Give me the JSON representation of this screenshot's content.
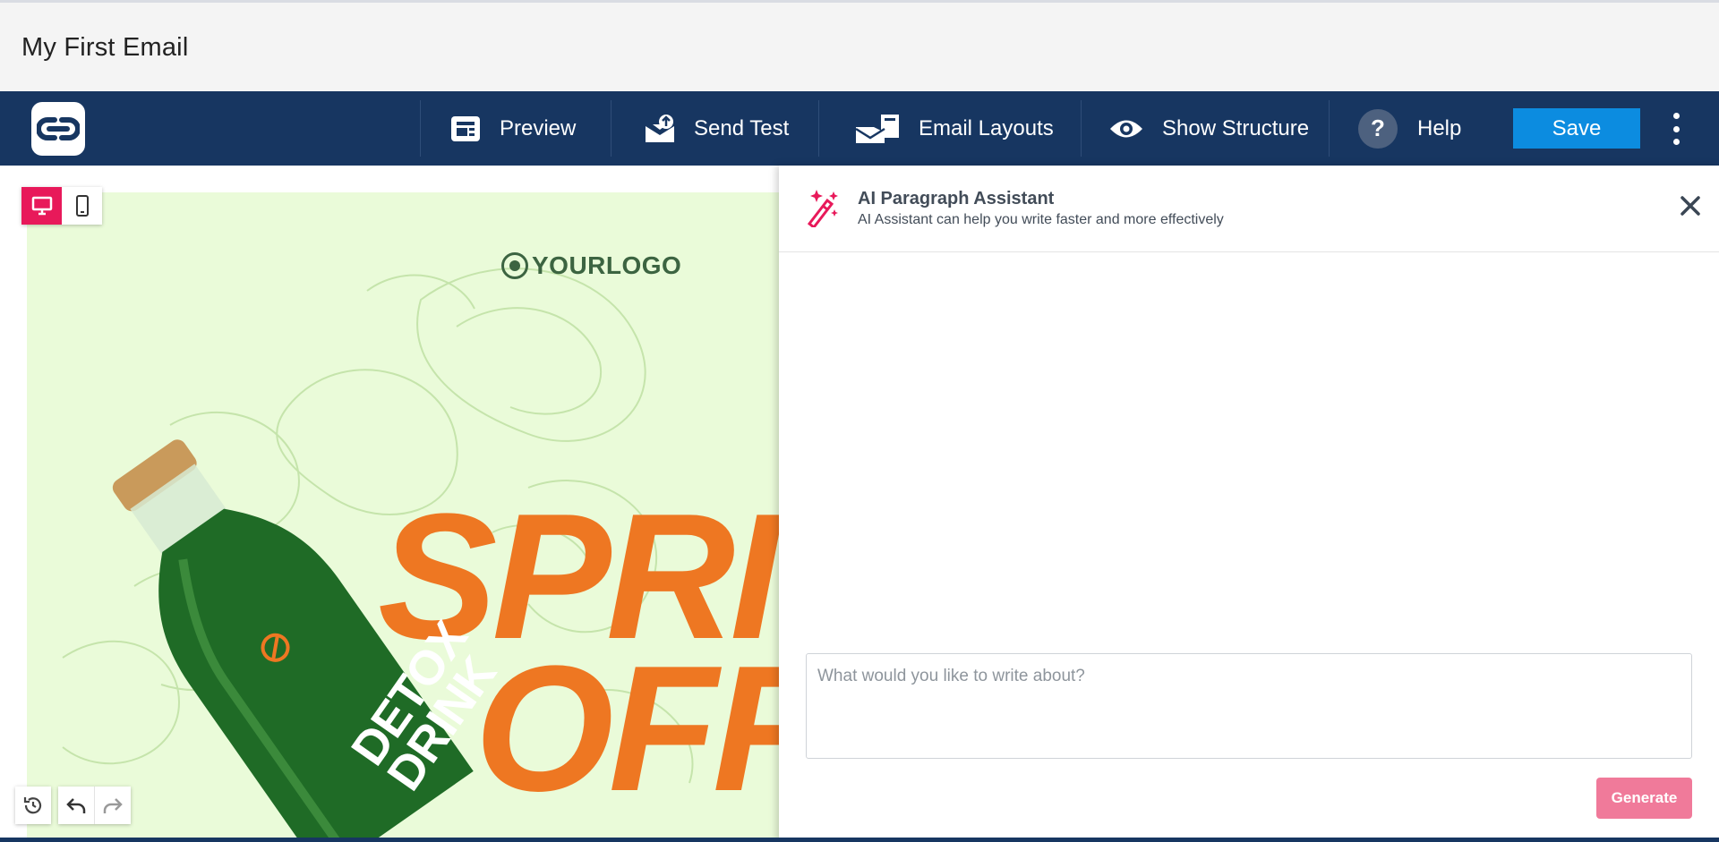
{
  "window": {
    "title": "My First Email"
  },
  "toolbar": {
    "preview_label": "Preview",
    "send_test_label": "Send Test",
    "email_layouts_label": "Email Layouts",
    "show_structure_label": "Show Structure",
    "help_label": "Help",
    "help_glyph": "?",
    "save_label": "Save"
  },
  "canvas": {
    "device_modes": [
      "desktop",
      "mobile"
    ],
    "active_device": "desktop",
    "email": {
      "logo_text": "YOURLOGO",
      "headline_line1": "SPRI",
      "headline_line2": "OFF",
      "product_label_line1": "DETOX",
      "product_label_line2": "DRINK"
    }
  },
  "ai_panel": {
    "title": "AI Paragraph Assistant",
    "subtitle": "AI Assistant can help you write faster and more effectively",
    "input_placeholder": "What would you like to write about?",
    "input_value": "",
    "generate_label": "Generate"
  },
  "colors": {
    "toolbar_bg": "#173661",
    "save_button": "#0c8ce0",
    "accent_pink": "#e8195a",
    "generate_button": "#f07a9a",
    "email_bg": "#eafbd9",
    "headline": "#ee7722"
  }
}
